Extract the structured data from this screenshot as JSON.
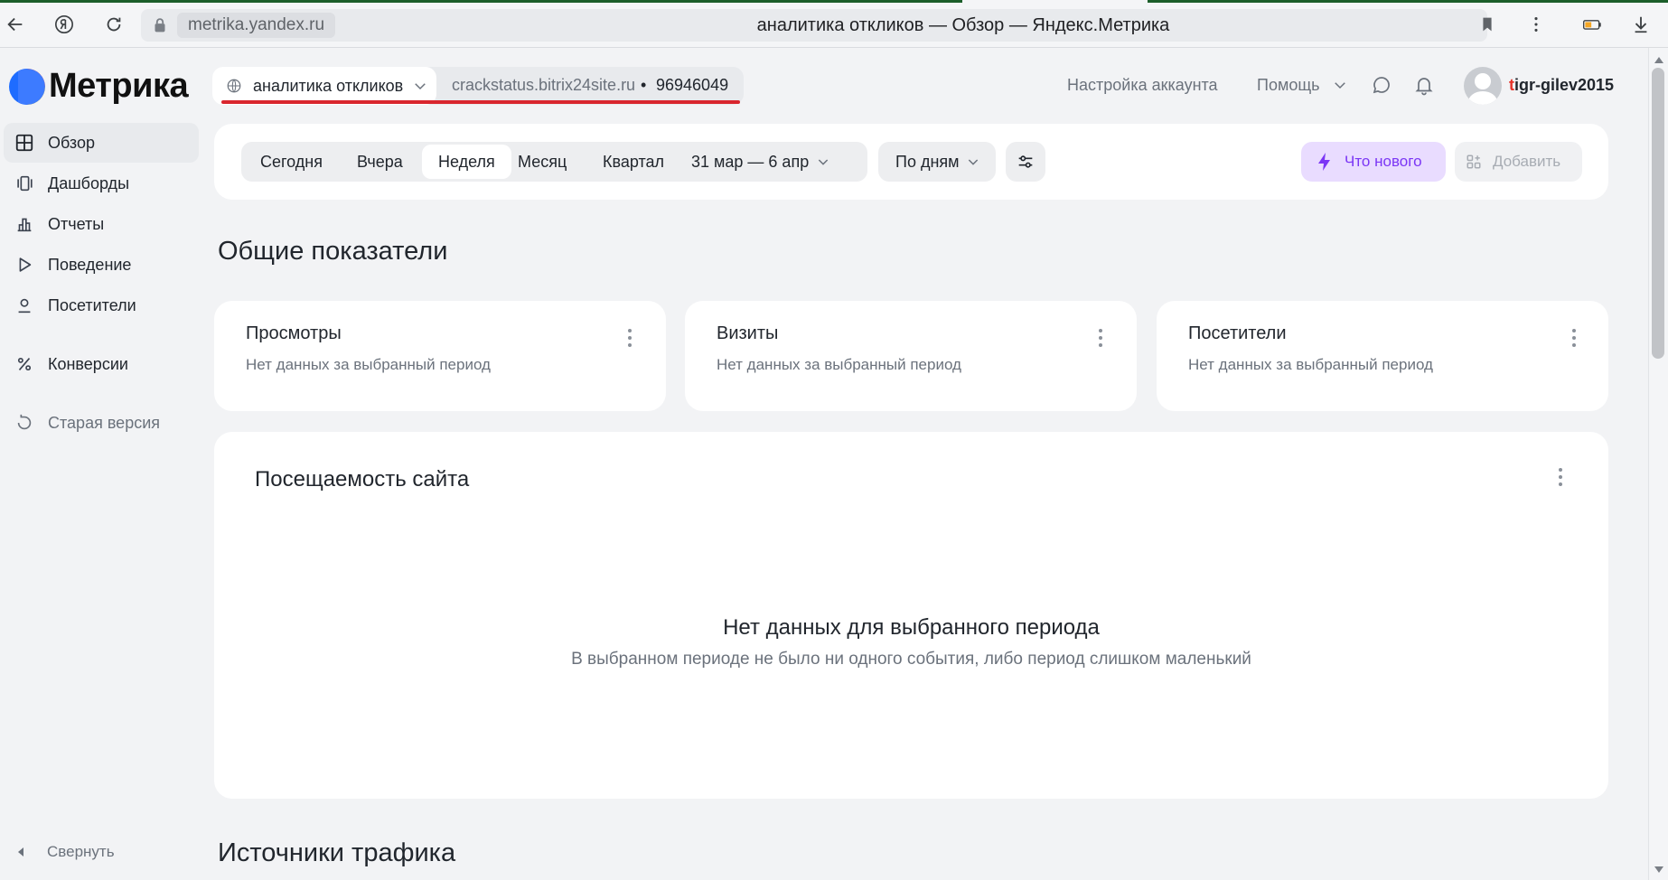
{
  "browser": {
    "url": "metrika.yandex.ru",
    "title": "аналитика откликов — Обзор — Яндекс.Метрика"
  },
  "header": {
    "logo": "Метрика",
    "counter_name": "аналитика откликов",
    "counter_site": "crackstatus.bitrix24site.ru",
    "counter_separator": "•",
    "counter_id": "96946049",
    "account_settings": "Настройка аккаунта",
    "help": "Помощь",
    "user_first": "t",
    "user_rest": "igr-gilev2015"
  },
  "sidebar": {
    "items": [
      {
        "label": "Обзор",
        "icon": "grid-icon",
        "active": true
      },
      {
        "label": "Дашборды",
        "icon": "dashboard-icon"
      },
      {
        "label": "Отчеты",
        "icon": "bar-chart-icon"
      },
      {
        "label": "Поведение",
        "icon": "play-icon"
      },
      {
        "label": "Посетители",
        "icon": "person-icon"
      },
      {
        "label": "Конверсии",
        "icon": "percent-icon"
      },
      {
        "label": "Старая версия",
        "icon": "history-icon"
      }
    ],
    "collapse": "Свернуть"
  },
  "toolbar": {
    "periods": [
      "Сегодня",
      "Вчера",
      "Неделя",
      "Месяц",
      "Квартал"
    ],
    "active_period": "Неделя",
    "date_range": "31 мар — 6 апр",
    "grouping": "По дням",
    "whats_new": "Что нового",
    "add": "Добавить"
  },
  "main": {
    "section_title": "Общие показатели",
    "kpis": [
      {
        "title": "Просмотры",
        "subtitle": "Нет данных за выбранный период"
      },
      {
        "title": "Визиты",
        "subtitle": "Нет данных за выбранный период"
      },
      {
        "title": "Посетители",
        "subtitle": "Нет данных за выбранный период"
      }
    ],
    "traffic": {
      "title": "Посещаемость сайта",
      "empty_title": "Нет данных для выбранного периода",
      "empty_subtitle": "В выбранном периоде не было ни одного события, либо период слишком маленький"
    },
    "sources_title": "Источники трафика"
  },
  "colors": {
    "accent_purple": "#7b36f5",
    "highlight_red": "#d9262e",
    "background": "#f2f3f5"
  }
}
